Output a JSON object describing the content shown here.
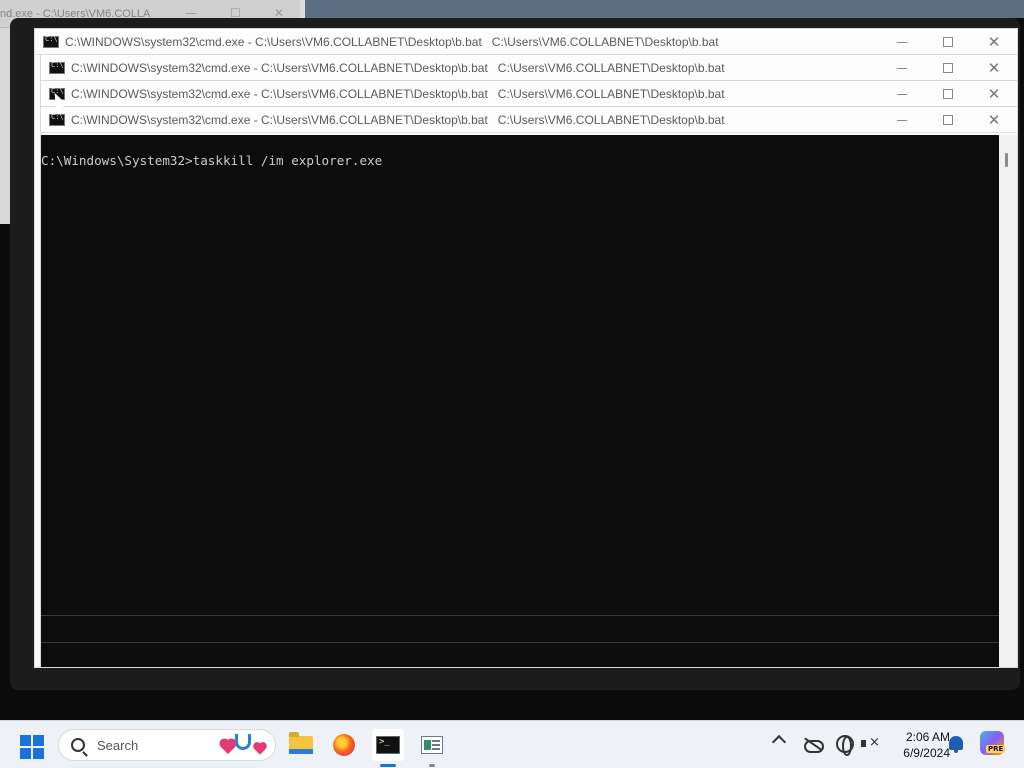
{
  "background_window": {
    "title": "nd.exe - C:\\Users\\VM6.COLLA"
  },
  "windows": [
    {
      "title": "C:\\WINDOWS\\system32\\cmd.exe - C:\\Users\\VM6.COLLABNET\\Desktop\\b.bat",
      "subtitle": "C:\\Users\\VM6.COLLABNET\\Desktop\\b.bat"
    },
    {
      "title": "C:\\WINDOWS\\system32\\cmd.exe - C:\\Users\\VM6.COLLABNET\\Desktop\\b.bat",
      "subtitle": "C:\\Users\\VM6.COLLABNET\\Desktop\\b.bat"
    },
    {
      "title": "C:\\WINDOWS\\system32\\cmd.exe - C:\\Users\\VM6.COLLABNET\\Desktop\\b.bat",
      "subtitle": "C:\\Users\\VM6.COLLABNET\\Desktop\\b.bat"
    },
    {
      "title": "C:\\WINDOWS\\system32\\cmd.exe - C:\\Users\\VM6.COLLABNET\\Desktop\\b.bat",
      "subtitle": "C:\\Users\\VM6.COLLABNET\\Desktop\\b.bat"
    }
  ],
  "console": {
    "line1": "C:\\Windows\\System32>taskkill /im explorer.exe"
  },
  "taskbar": {
    "search_placeholder": "Search",
    "apps": [
      "folder-icon",
      "firefox-icon",
      "terminal-icon",
      "window-app-icon"
    ],
    "clock_time": "2:06 AM",
    "clock_date": "6/9/2024",
    "copilot_badge": "PRE"
  },
  "colors": {
    "console_bg": "#0c0c0c",
    "console_fg": "#cccccc",
    "taskbar_bg": "#eef1f6",
    "accent": "#1a73d9"
  }
}
